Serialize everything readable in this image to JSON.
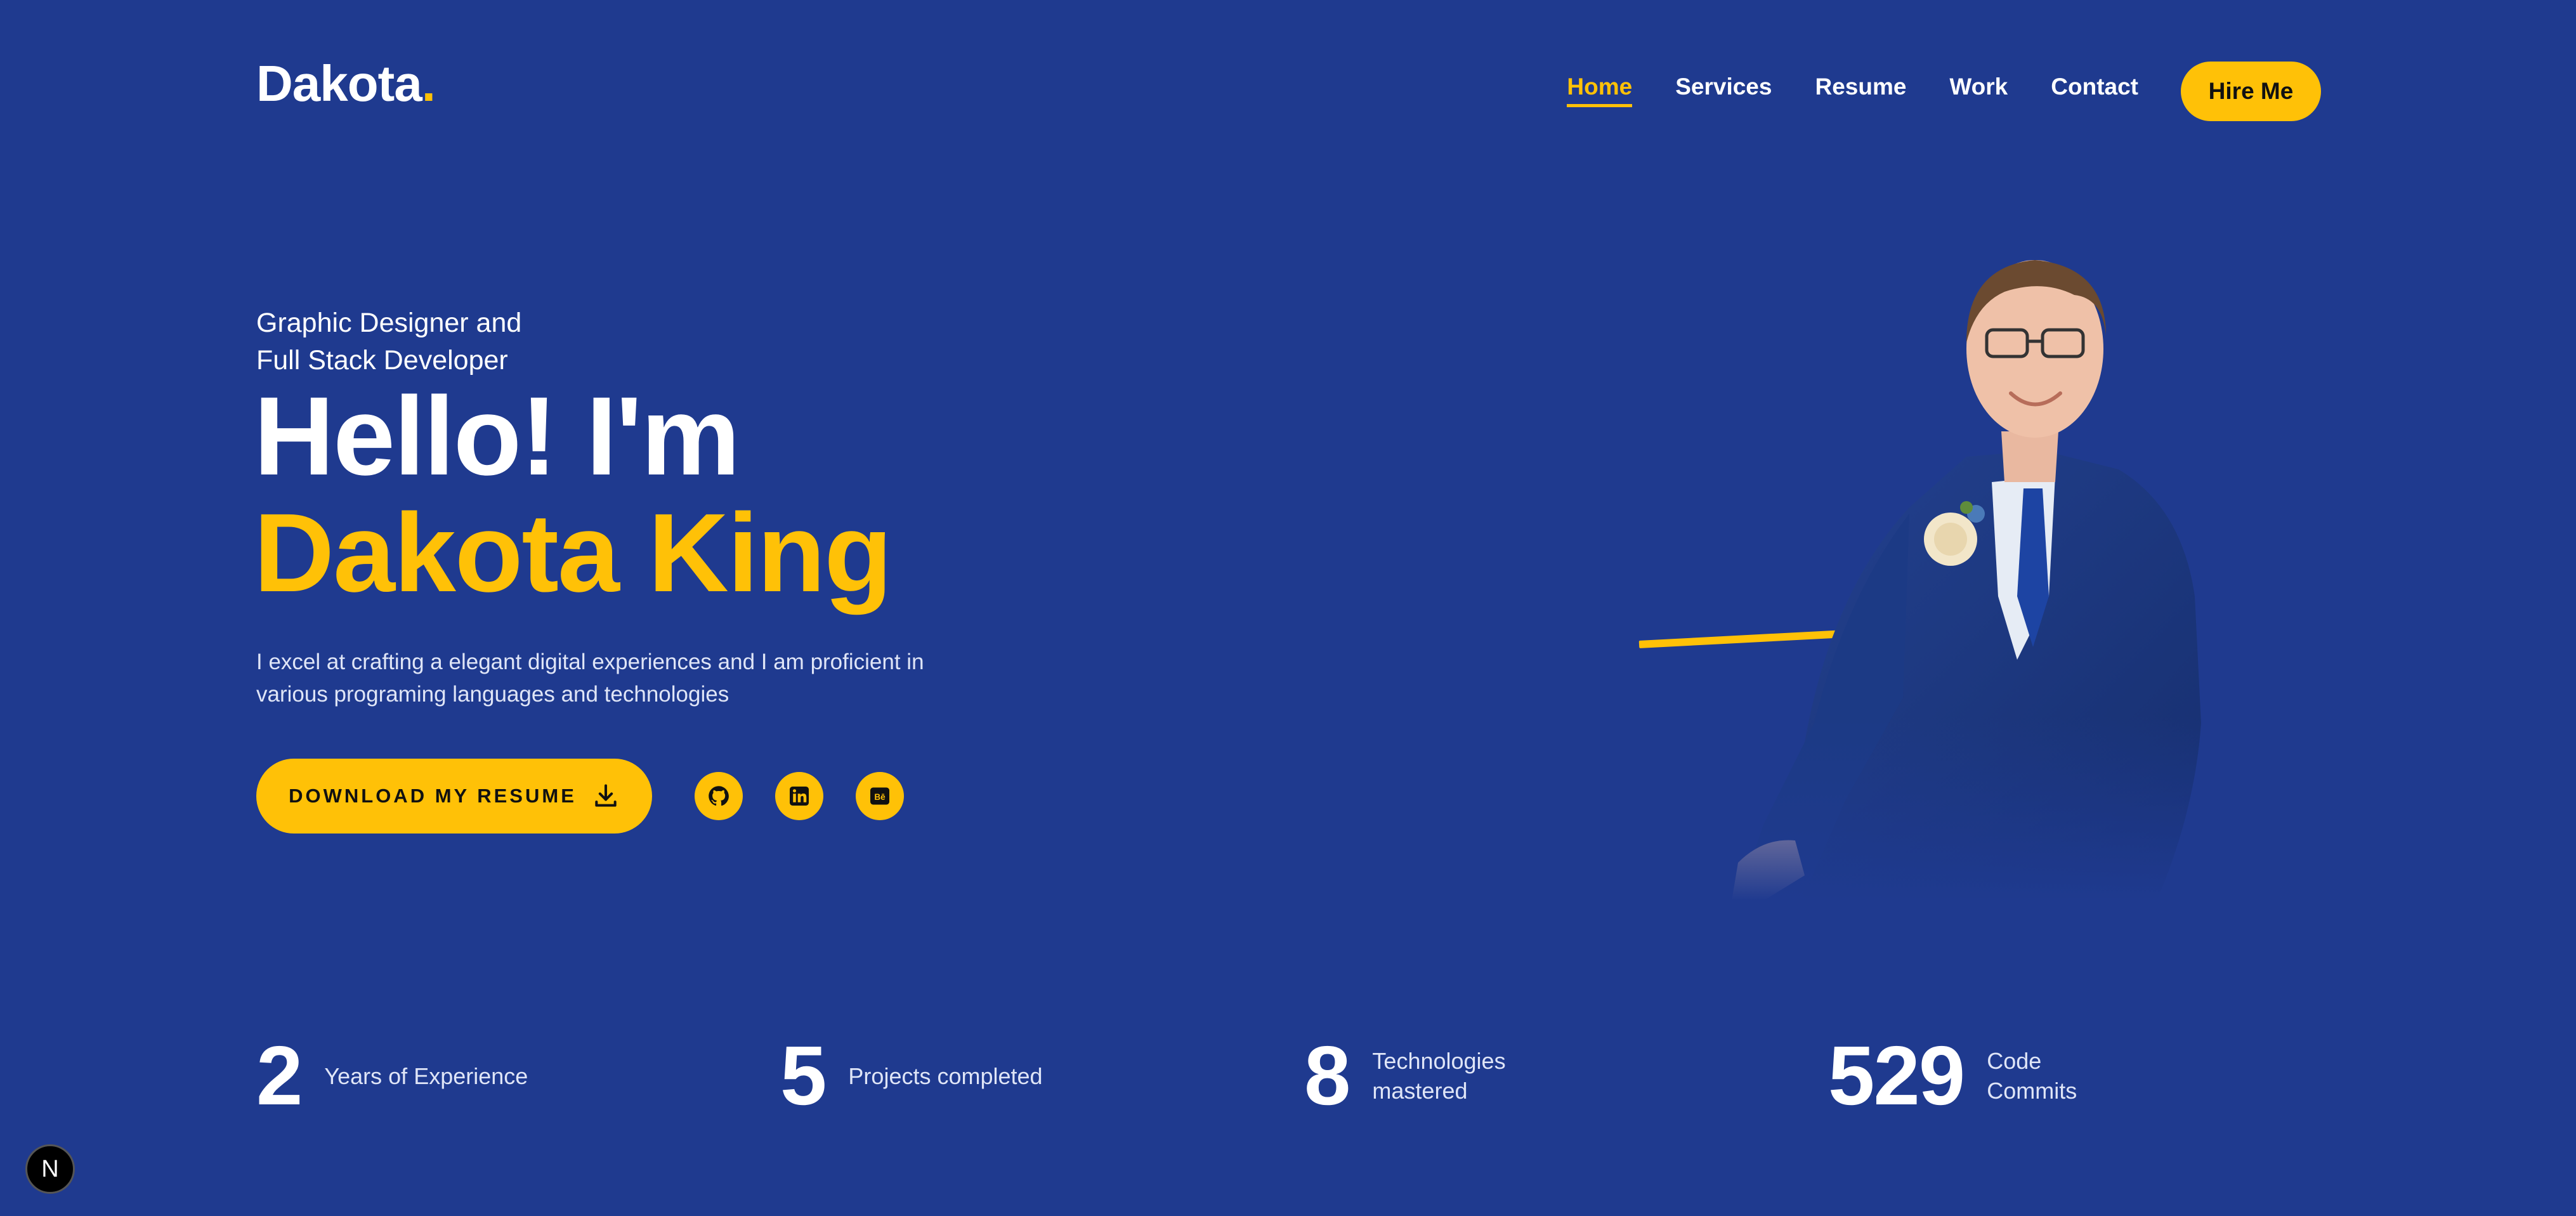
{
  "header": {
    "logo_text": "Dakota",
    "logo_dot": ".",
    "nav": [
      {
        "label": "Home",
        "active": true
      },
      {
        "label": "Services",
        "active": false
      },
      {
        "label": "Resume",
        "active": false
      },
      {
        "label": "Work",
        "active": false
      },
      {
        "label": "Contact",
        "active": false
      }
    ],
    "hire_label": "Hire Me"
  },
  "hero": {
    "subtitle_line1": "Graphic Designer and",
    "subtitle_line2": "Full Stack Developer",
    "greeting": "Hello! I'm",
    "name": "Dakota King",
    "description": "I excel at crafting a elegant digital experiences and I am proficient in various programing languages and technologies",
    "download_label": "DOWNLOAD MY RESUME",
    "socials": [
      {
        "icon": "github-icon"
      },
      {
        "icon": "linkedin-icon"
      },
      {
        "icon": "behance-icon"
      }
    ]
  },
  "stats": [
    {
      "value": "2",
      "label_line1": "Years of Experience",
      "label_line2": ""
    },
    {
      "value": "5",
      "label_line1": "Projects completed",
      "label_line2": ""
    },
    {
      "value": "8",
      "label_line1": "Technologies",
      "label_line2": "mastered"
    },
    {
      "value": "529",
      "label_line1": "Code",
      "label_line2": "Commits"
    }
  ],
  "dev_badge": "N",
  "colors": {
    "background": "#1f3a8f",
    "accent": "#ffc107",
    "text": "#ffffff"
  }
}
